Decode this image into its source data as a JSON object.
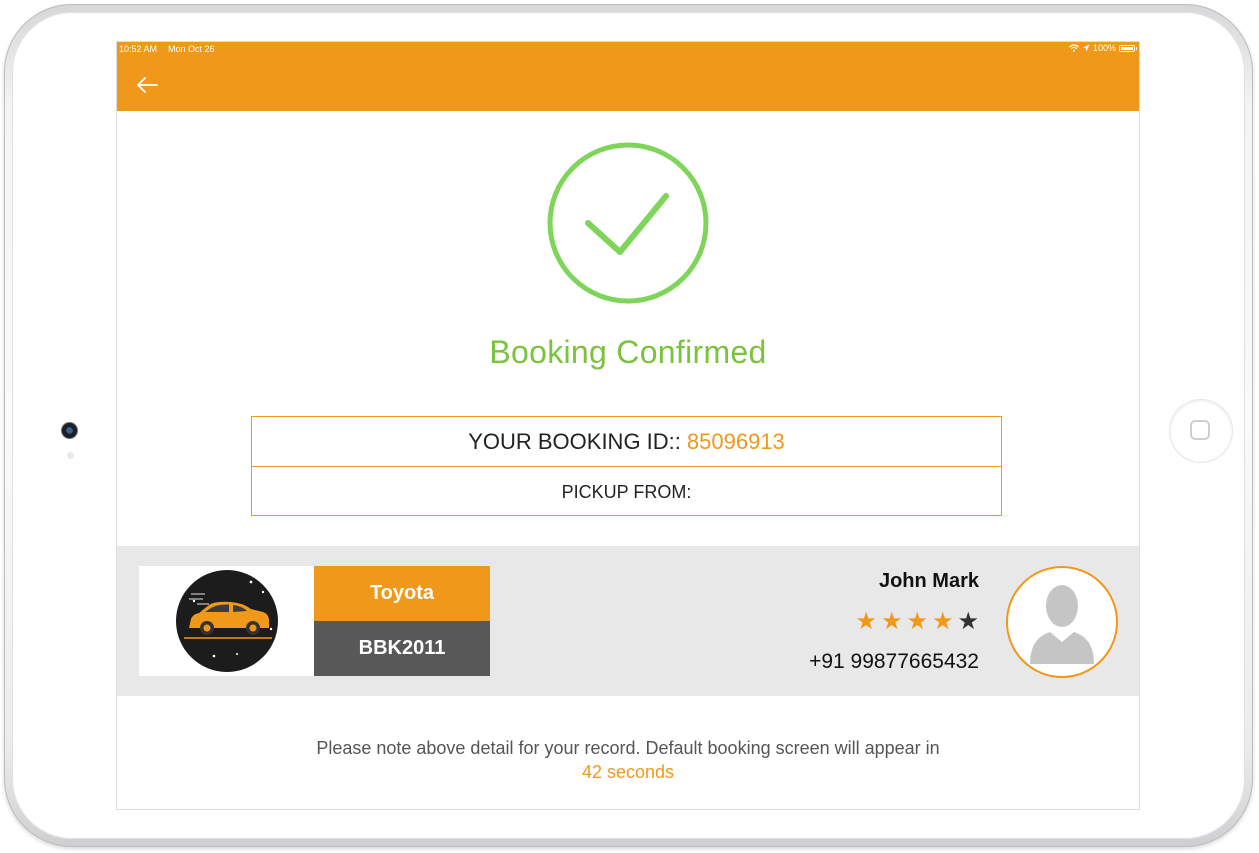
{
  "status_bar": {
    "time": "10:52 AM",
    "date": "Mon Oct 26",
    "battery": "100%"
  },
  "confirmation": {
    "title": "Booking Confirmed"
  },
  "booking": {
    "id_label": "YOUR BOOKING ID::",
    "id_value": "85096913",
    "pickup_label": "PICKUP FROM:"
  },
  "vehicle": {
    "brand": "Toyota",
    "plate": "BBK2011"
  },
  "driver": {
    "name": "John Mark",
    "rating": 4,
    "rating_max": 5,
    "phone": "+91 99877665432"
  },
  "footer": {
    "note": "Please note above detail for your record. Default booking screen will appear in",
    "countdown": "42 seconds"
  },
  "colors": {
    "accent": "#f0981a",
    "success": "#7cc23f",
    "star_filled": "#f0981a",
    "star_empty": "#333333"
  }
}
